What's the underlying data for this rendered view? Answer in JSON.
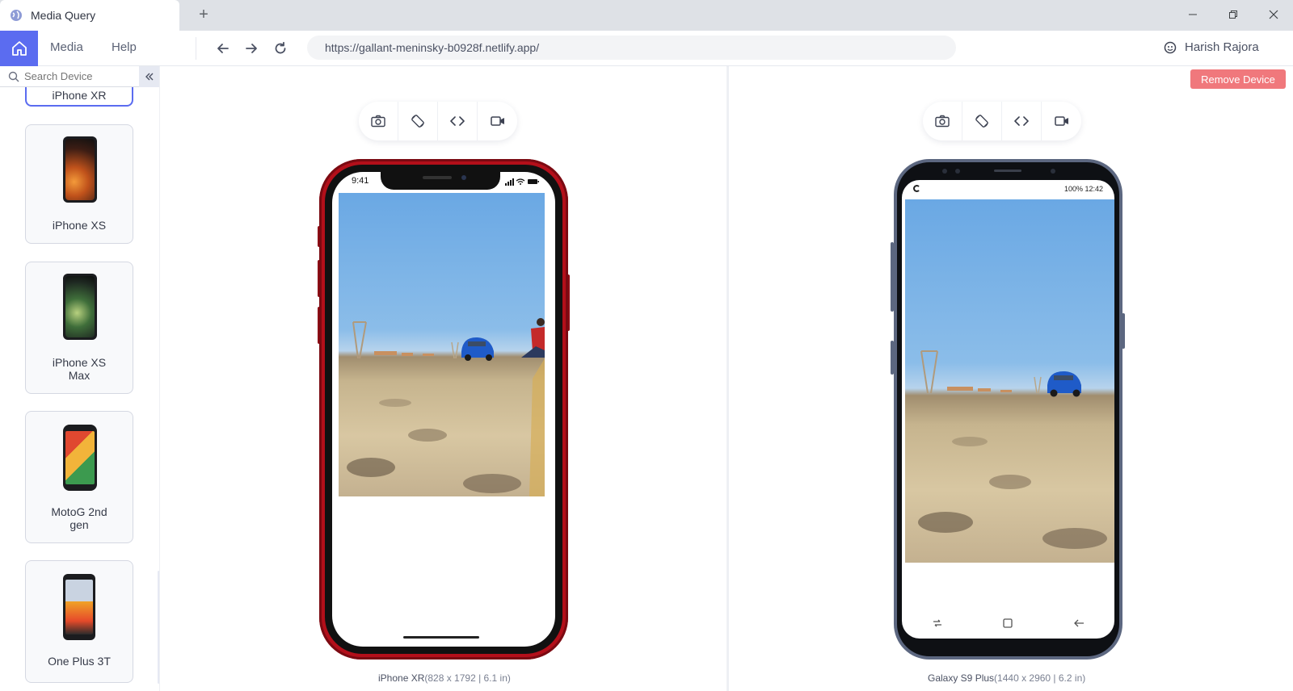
{
  "browser": {
    "tab_title": "Media Query",
    "new_tab_label": "+",
    "url": "https://gallant-meninsky-b0928f.netlify.app/"
  },
  "menu": {
    "items": [
      {
        "label": "Media"
      },
      {
        "label": "Help"
      }
    ]
  },
  "user": {
    "name": "Harish Rajora"
  },
  "sidebar": {
    "search_placeholder": "Search Device",
    "cards": [
      {
        "label": "iPhone XR",
        "active": true
      },
      {
        "label": "iPhone XS"
      },
      {
        "label": "iPhone XS Max"
      },
      {
        "label": "MotoG 2nd gen"
      },
      {
        "label": "One Plus 3T"
      }
    ]
  },
  "main": {
    "remove_label": "Remove Device",
    "devices": [
      {
        "name": "iPhone XR",
        "spec": "(828 x 1792 | 6.1 in)",
        "status_time": "9:41",
        "frame_color": "#b30f1a"
      },
      {
        "name": "Galaxy S9 Plus",
        "spec": "(1440 x 2960 | 6.2 in)",
        "status_text": "100% 12:42",
        "frame_color": "#5c6780"
      }
    ],
    "toolbar_icons": [
      "camera-icon",
      "rotate-icon",
      "code-icon",
      "video-icon"
    ]
  },
  "colors": {
    "accent": "#5b6cf0",
    "danger": "#f0787c"
  }
}
